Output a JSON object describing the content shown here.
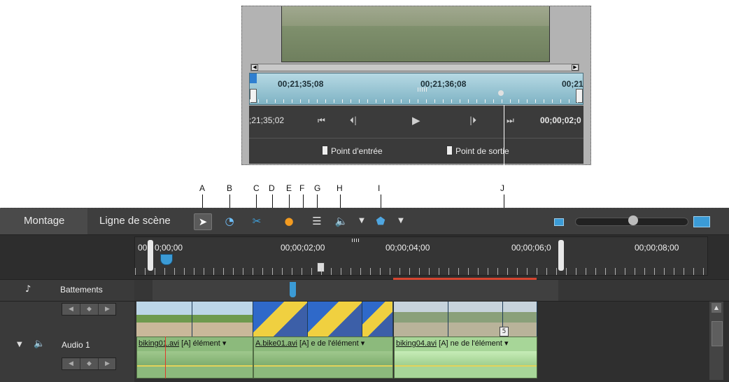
{
  "preview": {
    "timecodes": [
      "00;21;35;08",
      "00;21;36;08",
      "00;21"
    ],
    "transport": {
      "left_timecode": ";21;35;02",
      "right_timecode": "00;00;02;0",
      "buttons": [
        "⏮",
        "⏴|",
        "▶",
        "|⏵",
        "⏭"
      ]
    },
    "in_label": "Point d'entrée",
    "out_label": "Point de sortie"
  },
  "callouts": [
    "A",
    "B",
    "C",
    "D",
    "E",
    "F",
    "G",
    "H",
    "I",
    "J"
  ],
  "timeline": {
    "tabs": [
      "Montage",
      "Ligne de scène"
    ],
    "ruler_timecodes": [
      "00",
      "0;00;00",
      "00;00;02;00",
      "00;00;04;00",
      "00;00;06;0",
      "00;00;08;00"
    ],
    "tracks": {
      "beats_label": "Battements",
      "audio_label": "Audio 1"
    },
    "audio_clips": [
      {
        "file": "biking01.avi",
        "suffix": "[A] élément ▾"
      },
      {
        "file": "A.bike01.avi",
        "suffix": "[A] e de l'élément ▾"
      },
      {
        "file": "biking04.avi",
        "suffix": "[A] ne de l'élément ▾"
      }
    ],
    "clip_marker_number": "5"
  },
  "colors": {
    "panel_dark": "#2d2d2d",
    "accent_blue": "#3b9bd6",
    "audio_green": "#8cba7c",
    "work_area_red": "#d64530"
  }
}
